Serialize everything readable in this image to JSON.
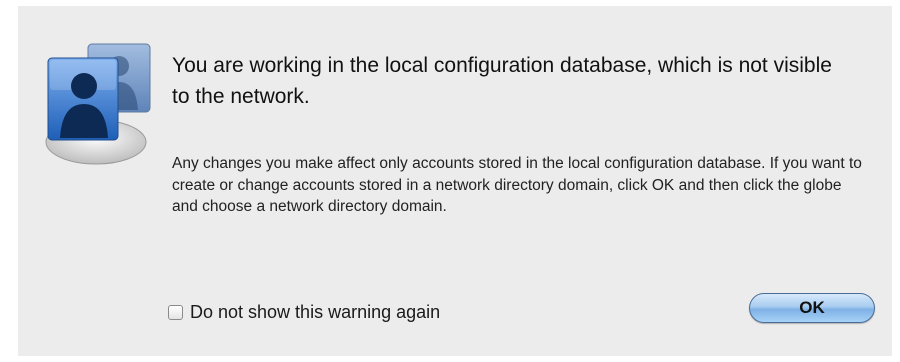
{
  "dialog": {
    "icon": "accounts-users-icon",
    "headline": "You are working in the local configuration database, which is not visible to the network.",
    "message": "Any changes you make affect only accounts stored in the local configuration database. If you want to create or change accounts stored in a network directory domain, click OK and then click the globe and choose a network directory domain.",
    "checkbox": {
      "label": "Do not show this warning again",
      "checked": false
    },
    "ok_label": "OK",
    "accent_color": "#7fb1e6"
  }
}
